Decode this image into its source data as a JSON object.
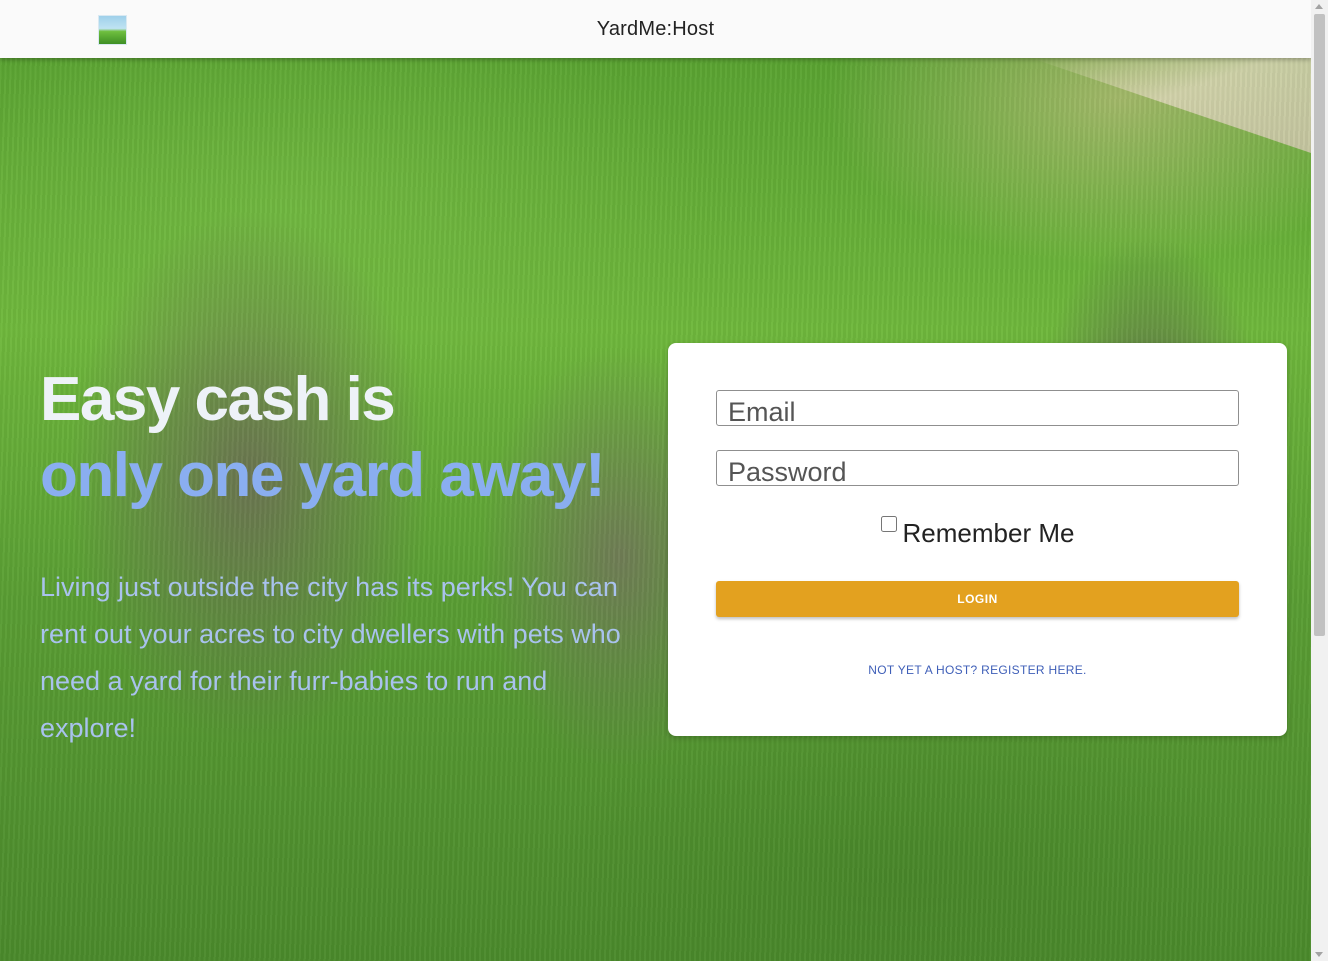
{
  "header": {
    "logo_icon": "yard-logo-icon",
    "title": "YardMe:Host"
  },
  "hero": {
    "headline_line1": "Easy cash is",
    "headline_line2": "only one yard away!",
    "blurb": "Living just outside the city has its perks! You can rent out your acres to city dwellers with pets who need a yard for their furr-babies to run and explore!",
    "colors": {
      "headline_line1": "#eef2f8",
      "headline_line2": "#8aaef0",
      "blurb": "#a9c2ee"
    }
  },
  "login": {
    "email_placeholder": "Email",
    "password_placeholder": "Password",
    "remember_label": "Remember Me",
    "remember_checked": false,
    "login_label": "LOGIN",
    "register_label": "NOT YET A HOST? REGISTER HERE.",
    "colors": {
      "login_button": "#e3a11f",
      "register_link": "#3f5fb8"
    }
  }
}
